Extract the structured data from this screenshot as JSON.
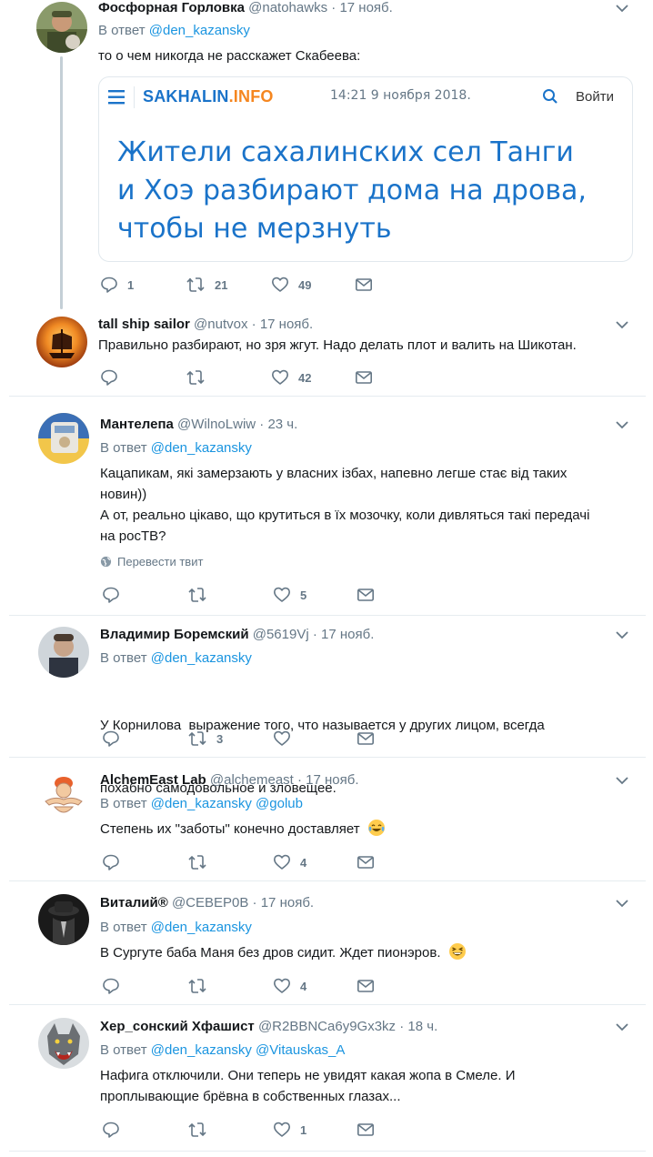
{
  "tweets": [
    {
      "name": "Фосфорная Горловка",
      "handle": "@natohawks",
      "time": "17 нояб.",
      "reply_prefix": "В ответ",
      "reply_to": [
        "@den_kazansky"
      ],
      "text": "то о чем никогда не расскажет Скабеева:",
      "counts": {
        "reply": "1",
        "retweet": "21",
        "like": "49"
      },
      "card": {
        "site": "SAKHALIN.INFO",
        "datetime": "14:21 9 ноября 2018.",
        "login": "Войти",
        "headline_lines": [
          "Жители сахалинских сел Танги",
          "и Хоэ разбирают дома на дрова,",
          "чтобы не мерзнуть"
        ]
      }
    },
    {
      "name": "tall ship sailor",
      "handle": "@nutvox",
      "time": "17 нояб.",
      "text": "Правильно разбирают, но зря жгут. Надо делать плот и валить на Шикотан.",
      "counts": {
        "reply": "",
        "retweet": "",
        "like": "42"
      }
    },
    {
      "name": "Мантелепа",
      "handle": "@WilnoLwiw",
      "time": "23 ч.",
      "reply_prefix": "В ответ",
      "reply_to": [
        "@den_kazansky"
      ],
      "text_lines": [
        "Кацапикам, які замерзають у власних ізбах, напевно легше стає від таких",
        "новин))",
        "А от, реально цікаво, що крутиться в їх мозочку, коли дивляться такі передачі",
        "на росТВ?"
      ],
      "translate": "Перевести твит",
      "counts": {
        "reply": "",
        "retweet": "",
        "like": "5"
      }
    },
    {
      "name": "Владимир Боремский",
      "handle": "@5619Vj",
      "time": "17 нояб.",
      "reply_prefix": "В ответ",
      "reply_to": [
        "@den_kazansky"
      ],
      "text_lines": [
        "У Корнилова  выражение того, что называется у других лицом, всегда",
        "похабно самодовольное и зловещее."
      ],
      "counts": {
        "reply": "",
        "retweet": "3",
        "like": ""
      }
    },
    {
      "name": "AlchemEast Lab",
      "handle": "@alchemeast",
      "time": "17 нояб.",
      "reply_prefix": "В ответ",
      "reply_to": [
        "@den_kazansky",
        "@golub"
      ],
      "text": "Степень их \"заботы\" конечно доставляет",
      "counts": {
        "reply": "",
        "retweet": "",
        "like": "4"
      }
    },
    {
      "name": "Виталий®",
      "handle": "@CEBEP0B",
      "time": "17 нояб.",
      "reply_prefix": "В ответ",
      "reply_to": [
        "@den_kazansky"
      ],
      "text": "В Сургуте баба Маня без дров сидит. Ждет пионэров.",
      "counts": {
        "reply": "",
        "retweet": "",
        "like": "4"
      }
    },
    {
      "name": "Хер_сонский Хфашист",
      "handle": "@R2BBNCa6y9Gx3kz",
      "time": "18 ч.",
      "reply_prefix": "В ответ",
      "reply_to": [
        "@den_kazansky",
        "@Vitauskas_A"
      ],
      "text_lines": [
        "Нафига отключили. Они теперь не увидят какая жопа в Смеле. И",
        "проплывающие брёвна в собственных глазах..."
      ],
      "counts": {
        "reply": "",
        "retweet": "",
        "like": "1"
      }
    }
  ],
  "dot": "·",
  "colors": {
    "link": "#1b95e0",
    "secondary": "#657786",
    "card_headline": "#1a73c9",
    "site_orange": "#f5861f",
    "site_blue": "#1a73c9"
  }
}
